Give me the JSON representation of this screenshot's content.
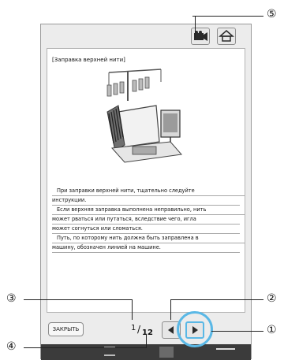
{
  "page": {
    "heading": "[Заправка верхней нити]",
    "paragraphs": [
      "При заправки верхней нити, тщательно следуйте",
      "инструкции.",
      "Если верхняя заправка выполнена неправильно, нить",
      "может рваться или путаться, вследствие чего, игла",
      "может согнуться или сломаться.",
      "Путь, по которому нить должна быть заправлена в",
      "машину, обозначен линией на машине."
    ]
  },
  "controls": {
    "close_label": "ЗАКРЫТЬ",
    "page_current": "1",
    "page_total": "12",
    "prev": "previous-page",
    "next": "next-page"
  },
  "callouts": [
    "①",
    "②",
    "③",
    "④",
    "⑤"
  ]
}
